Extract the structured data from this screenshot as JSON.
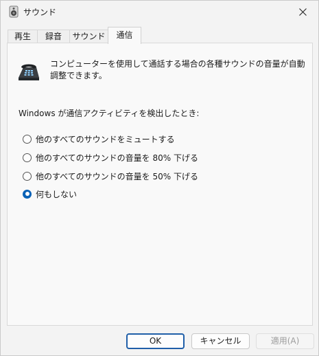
{
  "window": {
    "title": "サウンド"
  },
  "tabs": [
    {
      "label": "再生",
      "active": false
    },
    {
      "label": "録音",
      "active": false
    },
    {
      "label": "サウンド",
      "active": false
    },
    {
      "label": "通信",
      "active": true
    }
  ],
  "panel": {
    "description": "コンピューターを使用して通話する場合の各種サウンドの音量が自動調整できます。",
    "lead": "Windows が通信アクティビティを検出したとき:",
    "options": [
      {
        "label": "他のすべてのサウンドをミュートする",
        "checked": false
      },
      {
        "label": "他のすべてのサウンドの音量を 80% 下げる",
        "checked": false
      },
      {
        "label": "他のすべてのサウンドの音量を 50% 下げる",
        "checked": false
      },
      {
        "label": "何もしない",
        "checked": true
      }
    ]
  },
  "buttons": {
    "ok": "OK",
    "cancel": "キャンセル",
    "apply": "適用(A)"
  },
  "colors": {
    "accent": "#0a62b6",
    "focus_border": "#1f5ea8"
  },
  "icons": {
    "title": "speaker-icon",
    "close": "close-icon",
    "panel": "telephone-icon"
  }
}
